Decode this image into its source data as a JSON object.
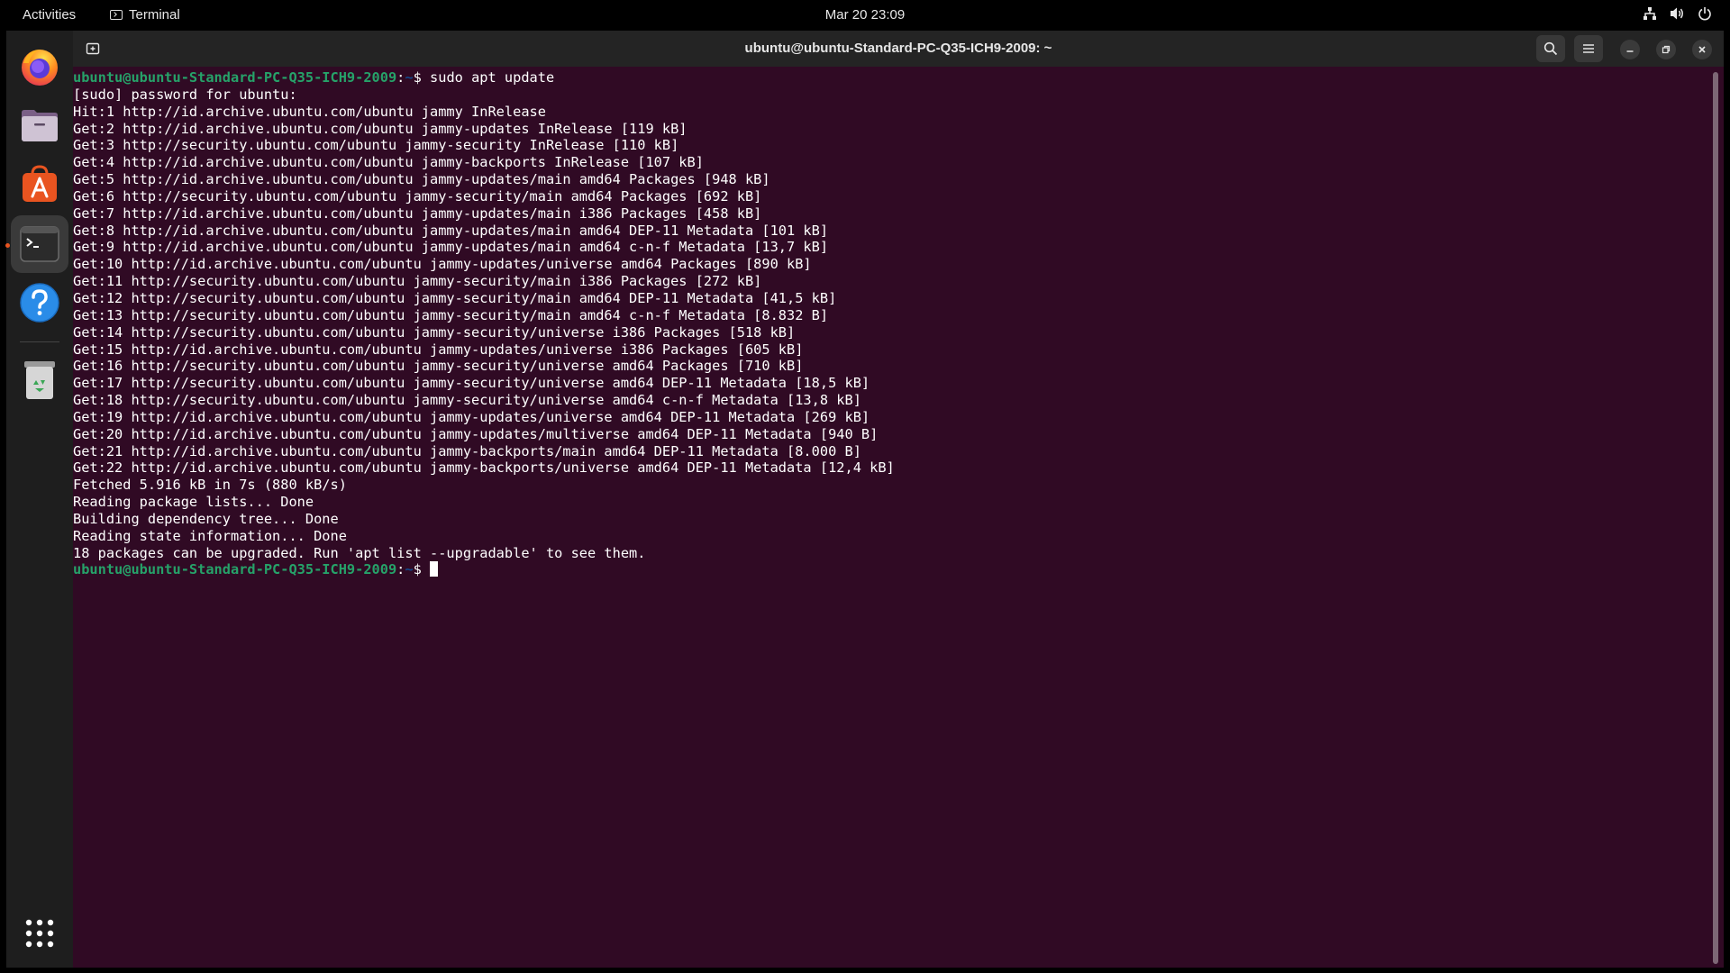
{
  "topbar": {
    "activities": "Activities",
    "app_name": "Terminal",
    "clock": "Mar 20  23:09",
    "icons": [
      "network-icon",
      "volume-icon",
      "power-icon"
    ]
  },
  "dock": {
    "items": [
      {
        "name": "firefox",
        "icon": "firefox-icon"
      },
      {
        "name": "files",
        "icon": "files-icon"
      },
      {
        "name": "app-center",
        "icon": "app-center-icon"
      },
      {
        "name": "terminal",
        "icon": "terminal-icon",
        "active": true
      },
      {
        "name": "help",
        "icon": "help-icon"
      },
      {
        "name": "trash",
        "icon": "trash-icon"
      },
      {
        "name": "show-apps",
        "icon": "grid-icon"
      }
    ]
  },
  "window": {
    "title": "ubuntu@ubuntu-Standard-PC-Q35-ICH9-2009: ~",
    "buttons": [
      "new-tab",
      "search",
      "menu",
      "minimize",
      "maximize",
      "close"
    ]
  },
  "terminal": {
    "prompt_user": "ubuntu@ubuntu-Standard-PC-Q35-ICH9-2009",
    "prompt_sep": ":",
    "prompt_path": "~",
    "prompt_symbol": "$ ",
    "command": "sudo apt update",
    "output_lines": [
      "[sudo] password for ubuntu:",
      "Hit:1 http://id.archive.ubuntu.com/ubuntu jammy InRelease",
      "Get:2 http://id.archive.ubuntu.com/ubuntu jammy-updates InRelease [119 kB]",
      "Get:3 http://security.ubuntu.com/ubuntu jammy-security InRelease [110 kB]",
      "Get:4 http://id.archive.ubuntu.com/ubuntu jammy-backports InRelease [107 kB]",
      "Get:5 http://id.archive.ubuntu.com/ubuntu jammy-updates/main amd64 Packages [948 kB]",
      "Get:6 http://security.ubuntu.com/ubuntu jammy-security/main amd64 Packages [692 kB]",
      "Get:7 http://id.archive.ubuntu.com/ubuntu jammy-updates/main i386 Packages [458 kB]",
      "Get:8 http://id.archive.ubuntu.com/ubuntu jammy-updates/main amd64 DEP-11 Metadata [101 kB]",
      "Get:9 http://id.archive.ubuntu.com/ubuntu jammy-updates/main amd64 c-n-f Metadata [13,7 kB]",
      "Get:10 http://id.archive.ubuntu.com/ubuntu jammy-updates/universe amd64 Packages [890 kB]",
      "Get:11 http://security.ubuntu.com/ubuntu jammy-security/main i386 Packages [272 kB]",
      "Get:12 http://security.ubuntu.com/ubuntu jammy-security/main amd64 DEP-11 Metadata [41,5 kB]",
      "Get:13 http://security.ubuntu.com/ubuntu jammy-security/main amd64 c-n-f Metadata [8.832 B]",
      "Get:14 http://security.ubuntu.com/ubuntu jammy-security/universe i386 Packages [518 kB]",
      "Get:15 http://id.archive.ubuntu.com/ubuntu jammy-updates/universe i386 Packages [605 kB]",
      "Get:16 http://security.ubuntu.com/ubuntu jammy-security/universe amd64 Packages [710 kB]",
      "Get:17 http://security.ubuntu.com/ubuntu jammy-security/universe amd64 DEP-11 Metadata [18,5 kB]",
      "Get:18 http://security.ubuntu.com/ubuntu jammy-security/universe amd64 c-n-f Metadata [13,8 kB]",
      "Get:19 http://id.archive.ubuntu.com/ubuntu jammy-updates/universe amd64 DEP-11 Metadata [269 kB]",
      "Get:20 http://id.archive.ubuntu.com/ubuntu jammy-updates/multiverse amd64 DEP-11 Metadata [940 B]",
      "Get:21 http://id.archive.ubuntu.com/ubuntu jammy-backports/main amd64 DEP-11 Metadata [8.000 B]",
      "Get:22 http://id.archive.ubuntu.com/ubuntu jammy-backports/universe amd64 DEP-11 Metadata [12,4 kB]",
      "Fetched 5.916 kB in 7s (880 kB/s)",
      "Reading package lists... Done",
      "Building dependency tree... Done",
      "Reading state information... Done",
      "18 packages can be upgraded. Run 'apt list --upgradable' to see them."
    ]
  },
  "colors": {
    "terminal_bg": "#300a24",
    "prompt_user": "#26a269",
    "prompt_path": "#12488b",
    "accent": "#e95420"
  }
}
